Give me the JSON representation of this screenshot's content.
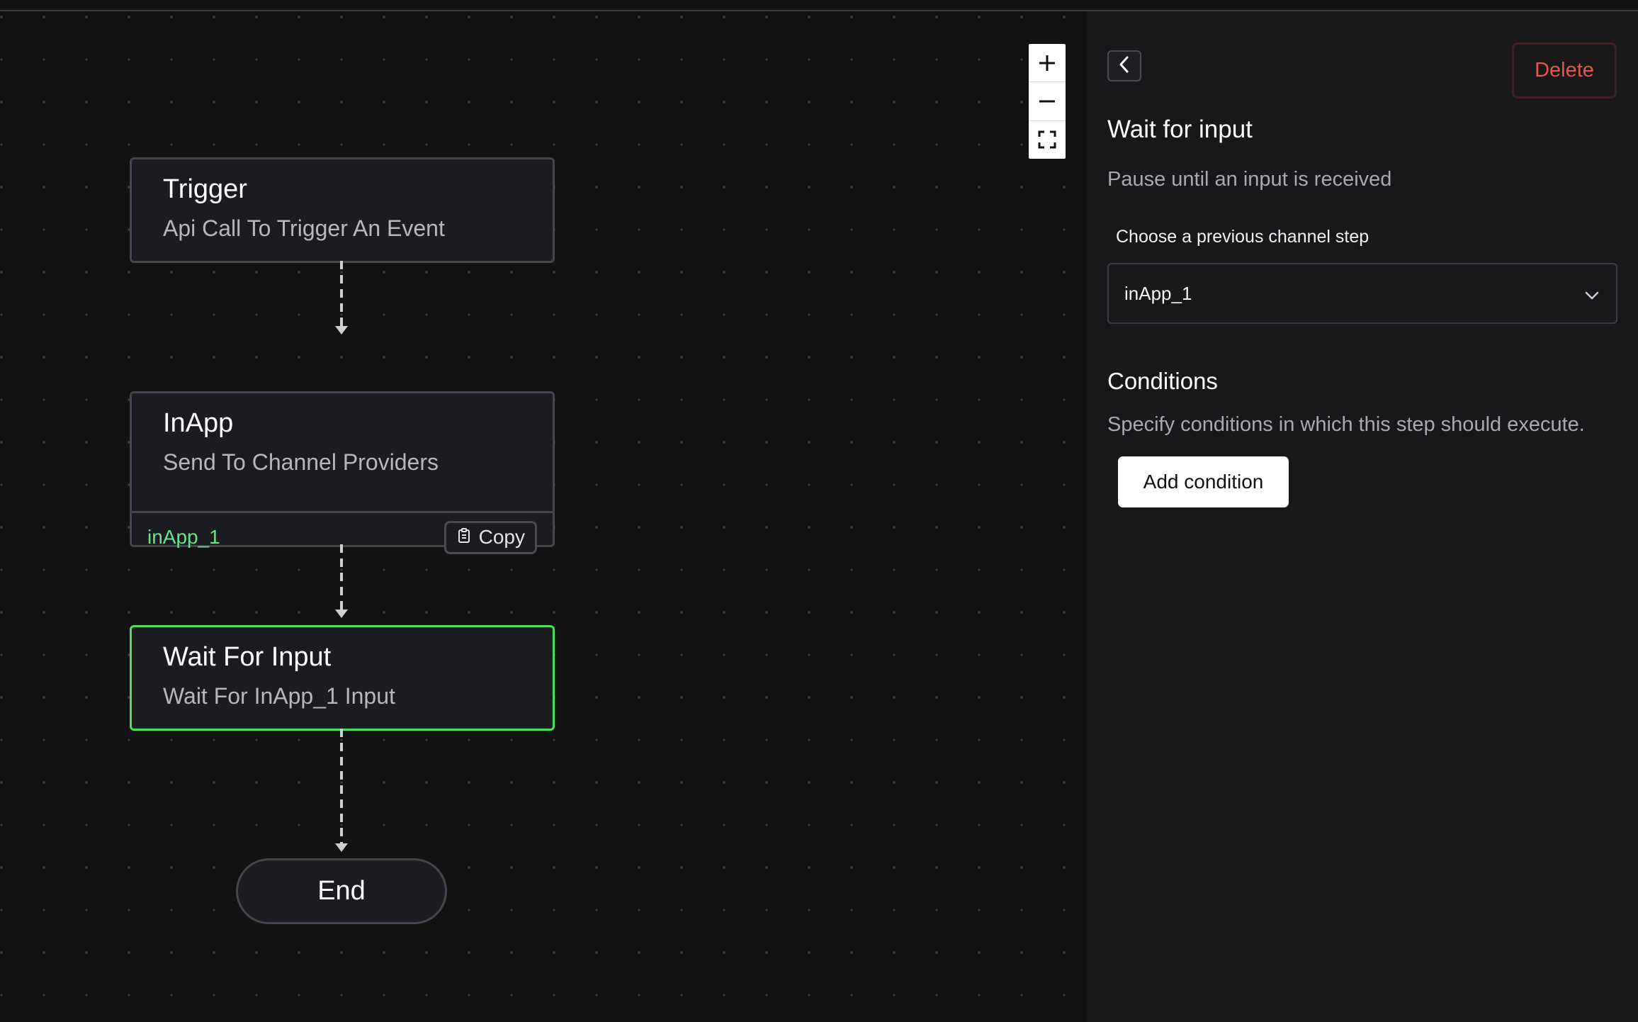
{
  "canvas": {
    "nodes": [
      {
        "title": "Trigger",
        "subtitle": "Api Call To Trigger An Event"
      },
      {
        "title": "InApp",
        "subtitle": "Send To Channel Providers",
        "step_id": "inApp_1",
        "copy_label": "Copy"
      },
      {
        "title": "Wait For Input",
        "subtitle": "Wait For InApp_1 Input",
        "selected": true
      }
    ],
    "end_label": "End",
    "zoom_controls": [
      "zoom-in-icon",
      "zoom-out-icon",
      "fit-view-icon"
    ]
  },
  "sidebar": {
    "back_icon": "chevron-left-icon",
    "delete_label": "Delete",
    "title": "Wait for input",
    "description": "Pause until an input is received",
    "channel_field": {
      "label": "Choose a previous channel step",
      "value": "inApp_1"
    },
    "conditions": {
      "title": "Conditions",
      "description": "Specify conditions in which this step should execute.",
      "add_label": "Add condition"
    }
  },
  "colors": {
    "selected_border": "#4ade5c",
    "step_id_text": "#6fe08c",
    "delete_text": "#e0584f"
  }
}
